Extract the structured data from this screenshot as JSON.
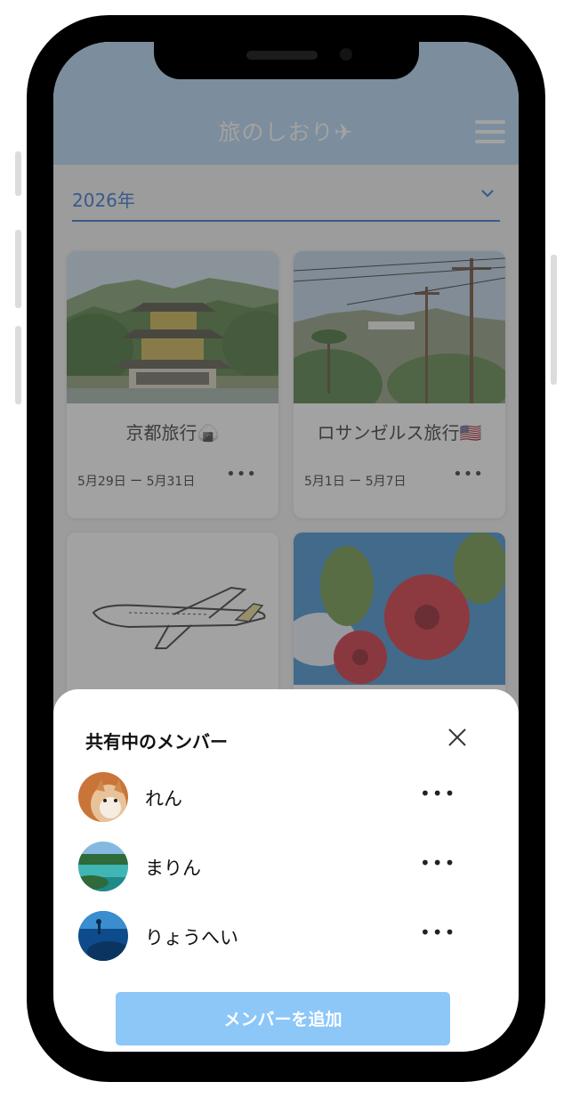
{
  "header": {
    "title": "旅のしおり✈",
    "menu_icon": "hamburger-menu-icon"
  },
  "year_select": {
    "value": "2026年",
    "icon": "chevron-down-icon"
  },
  "trips": [
    {
      "title": "京都旅行🍙",
      "dates": "5月29日 ー 5月31日",
      "more": "•••",
      "photo": "kinkakuji-temple"
    },
    {
      "title": "ロサンゼルス旅行🇺🇸",
      "dates": "5月1日 ー 5月7日",
      "more": "•••",
      "photo": "hollywood-hills"
    },
    {
      "title": "",
      "dates": "",
      "more": "",
      "photo": "airplane-illustration"
    },
    {
      "title": "",
      "dates": "",
      "more": "",
      "photo": "hibiscus-flowers"
    }
  ],
  "members_sheet": {
    "title": "共有中のメンバー",
    "close_icon": "close-icon",
    "members": [
      {
        "name": "れん",
        "more": "•••",
        "avatar": "shiba-dog"
      },
      {
        "name": "まりん",
        "more": "•••",
        "avatar": "beach"
      },
      {
        "name": "りょうへい",
        "more": "•••",
        "avatar": "underwater"
      }
    ],
    "add_button": "メンバーを追加"
  },
  "colors": {
    "header": "#b2d4f5",
    "accent": "#2b6fd1",
    "add_button": "#8cc7f8",
    "overlay": "#464646"
  }
}
